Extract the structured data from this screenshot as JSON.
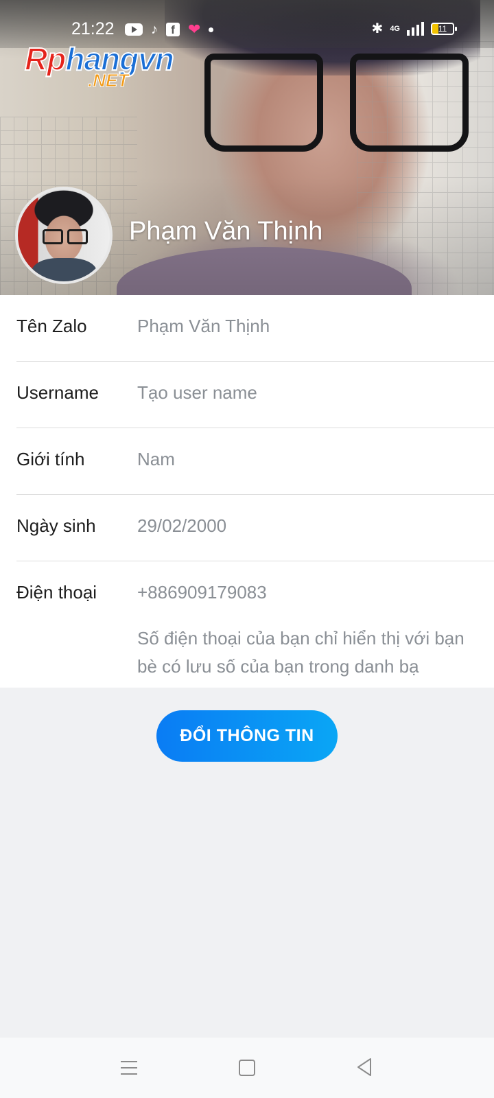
{
  "status_bar": {
    "time": "21:22",
    "left_icons": [
      "youtube-icon",
      "tiktok-icon",
      "facebook-icon",
      "heart-icon",
      "dot-icon"
    ],
    "right_icons": [
      "bluetooth-icon",
      "4g-signal-icon",
      "battery-icon"
    ],
    "network": "4G",
    "battery_level": "11"
  },
  "watermark": {
    "main": "Rphangvn",
    "sub": ".NET"
  },
  "profile": {
    "name": "Phạm Văn Thịnh"
  },
  "fields": [
    {
      "label": "Tên Zalo",
      "value": "Phạm Văn Thịnh"
    },
    {
      "label": "Username",
      "value": "Tạo user name"
    },
    {
      "label": "Giới tính",
      "value": "Nam"
    },
    {
      "label": "Ngày sinh",
      "value": "29/02/2000"
    },
    {
      "label": "Điện thoại",
      "value": "+886909179083",
      "note": "Số điện thoại của bạn chỉ hiển thị với bạn bè có lưu số của bạn trong danh bạ"
    }
  ],
  "action": {
    "label": "ĐỔI THÔNG TIN"
  },
  "colors": {
    "accent": "#0a8ff5",
    "label_text": "#1d1d1d",
    "value_text": "#8a8f95",
    "background": "#f0f1f3"
  },
  "nav_bar": {
    "icons": [
      "menu-icon",
      "home-icon",
      "back-icon"
    ]
  }
}
